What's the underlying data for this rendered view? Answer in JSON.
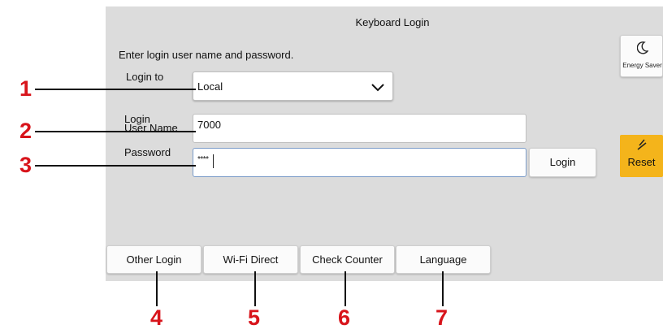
{
  "screen": {
    "title": "Keyboard Login",
    "instruction": "Enter login user name and password."
  },
  "form": {
    "login_to_label": "Login to",
    "login_to_value": "Local",
    "user_label_line1": "Login",
    "user_label_line2": "User Name",
    "user_value": "7000",
    "password_label": "Password",
    "password_value": "****",
    "login_button": "Login"
  },
  "side_buttons": {
    "energy_saver": "Energy Saver",
    "energy_icon": "moon-icon",
    "reset": "Reset",
    "reset_icon": "slash-icon",
    "reset_color": "#f4b41b"
  },
  "bottom_buttons": [
    "Other Login",
    "Wi-Fi Direct",
    "Check Counter",
    "Language"
  ],
  "callouts": {
    "color": "#d8141b",
    "numbers": [
      "1",
      "2",
      "3",
      "4",
      "5",
      "6",
      "7"
    ]
  }
}
